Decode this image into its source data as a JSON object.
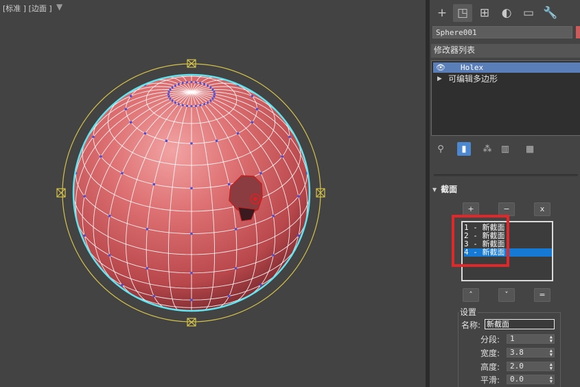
{
  "viewport": {
    "label": "[标准 ] [边面 ]",
    "filter_icon": "filter-icon"
  },
  "panel": {
    "tabs": [
      {
        "icon": "create-icon",
        "glyph": "+"
      },
      {
        "icon": "modify-icon",
        "glyph": "◳",
        "active": true
      },
      {
        "icon": "hierarchy-icon",
        "glyph": "⊞"
      },
      {
        "icon": "motion-icon",
        "glyph": "◐"
      },
      {
        "icon": "display-icon",
        "glyph": "▭"
      },
      {
        "icon": "utilities-icon",
        "glyph": "🔧"
      }
    ],
    "object_name": "Sphere001",
    "object_color": "#cf5a5a",
    "modifier_list": "修改器列表",
    "stack": [
      {
        "label": "Holex",
        "selected": true
      },
      {
        "label": "可编辑多边形",
        "selected": false
      }
    ],
    "stack_tools": [
      {
        "icon": "pin-stack-icon",
        "glyph": "📌"
      },
      {
        "icon": "show-end-result-icon",
        "glyph": "▮",
        "active": true
      },
      {
        "icon": "make-unique-icon",
        "glyph": "⁂"
      },
      {
        "icon": "remove-modifier-icon",
        "glyph": "🗑"
      },
      {
        "icon": "configure-modifier-sets-icon",
        "glyph": "▦"
      }
    ]
  },
  "rollout": {
    "title": "截面",
    "add_button": "+",
    "remove_button": "−",
    "delete_button": "x",
    "up_button": "˄",
    "down_button": "˅",
    "equal_button": "=",
    "sections": [
      {
        "label": "1 - 新截面",
        "selected": false
      },
      {
        "label": "2 - 新截面",
        "selected": false
      },
      {
        "label": "3 - 新截面",
        "selected": false
      },
      {
        "label": "4 - 新截面",
        "selected": true
      }
    ],
    "settings": {
      "group_title": "设置",
      "name_label": "名称:",
      "name_value": "新截面",
      "segments_label": "分段:",
      "segments_value": "1",
      "width_label": "宽度:",
      "width_value": "3.8",
      "height_label": "高度:",
      "height_value": "2.0",
      "smooth_label": "平滑:",
      "smooth_value": "0.0"
    }
  },
  "colors": {
    "selection_blue": "#1679d3",
    "highlight_red": "#e0282a",
    "sphere": "#d8696b",
    "wire": "#ffffff",
    "vertex": "#4a4fd6",
    "outline": "#5fe6f0",
    "gizmo": "#d6c34a"
  }
}
